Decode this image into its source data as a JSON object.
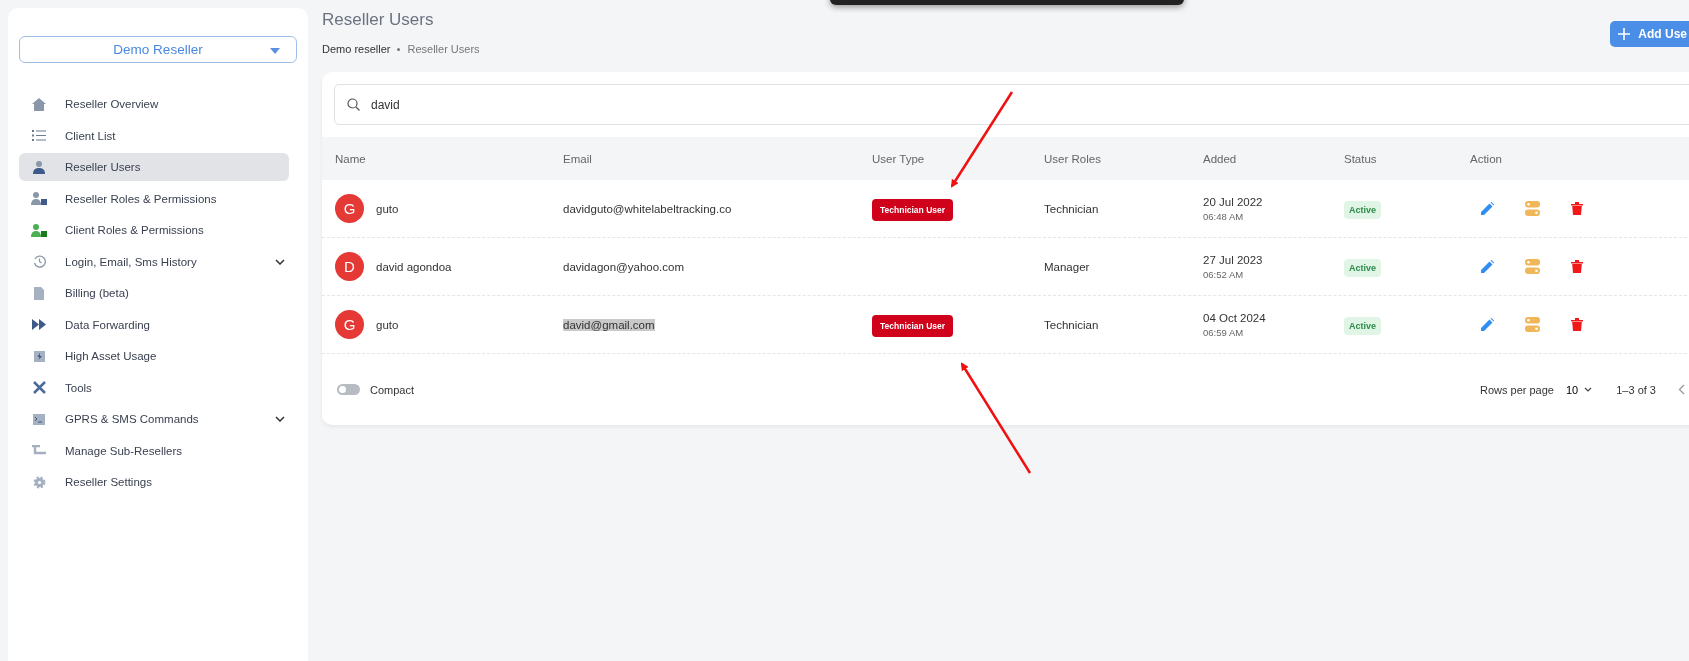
{
  "sidebar": {
    "reseller_select": "Demo Reseller",
    "items": [
      {
        "label": "Reseller Overview",
        "kind": "home",
        "selected": false,
        "expandable": false
      },
      {
        "label": "Client List",
        "kind": "list",
        "selected": false,
        "expandable": false
      },
      {
        "label": "Reseller Users",
        "kind": "user",
        "selected": true,
        "expandable": false
      },
      {
        "label": "Reseller Roles & Permissions",
        "kind": "reseller-roles",
        "selected": false,
        "expandable": false
      },
      {
        "label": "Client Roles & Permissions",
        "kind": "client-roles",
        "selected": false,
        "expandable": false
      },
      {
        "label": "Login, Email, Sms History",
        "kind": "history",
        "selected": false,
        "expandable": true
      },
      {
        "label": "Billing (beta)",
        "kind": "billing",
        "selected": false,
        "expandable": false
      },
      {
        "label": "Data Forwarding",
        "kind": "forwarding",
        "selected": false,
        "expandable": false
      },
      {
        "label": "High Asset Usage",
        "kind": "usage",
        "selected": false,
        "expandable": false
      },
      {
        "label": "Tools",
        "kind": "tools",
        "selected": false,
        "expandable": false
      },
      {
        "label": "GPRS & SMS Commands",
        "kind": "commands",
        "selected": false,
        "expandable": true
      },
      {
        "label": "Manage Sub-Resellers",
        "kind": "sub-resellers",
        "selected": false,
        "expandable": false
      },
      {
        "label": "Reseller Settings",
        "kind": "settings",
        "selected": false,
        "expandable": false
      }
    ]
  },
  "page": {
    "title": "Reseller Users",
    "breadcrumb": [
      "Demo reseller",
      "Reseller Users"
    ],
    "add_button": "Add Use"
  },
  "search": {
    "value": "david"
  },
  "table": {
    "columns": [
      "Name",
      "Email",
      "User Type",
      "User Roles",
      "Added",
      "Status",
      "Action"
    ],
    "rows": [
      {
        "initial": "G",
        "name": "guto",
        "email": "davidguto@whitelabeltracking.co",
        "email_highlighted": false,
        "user_type": "Technician User",
        "role": "Technician",
        "date": "20 Jul 2022",
        "time": "06:48 AM",
        "status": "Active"
      },
      {
        "initial": "D",
        "name": "david agondoa",
        "email": "davidagon@yahoo.com",
        "email_highlighted": false,
        "role": "Manager",
        "date": "27 Jul 2023",
        "time": "06:52 AM",
        "status": "Active"
      },
      {
        "initial": "G",
        "name": "guto",
        "email": "david@gmail.com",
        "email_highlighted": true,
        "user_type": "Technician User",
        "role": "Technician",
        "date": "04 Oct 2024",
        "time": "06:59 AM",
        "status": "Active"
      }
    ]
  },
  "footer": {
    "compact": {
      "label": "Compact",
      "on": false
    },
    "rows_per_page_label": "Rows per page",
    "rows_per_page": "10",
    "range": "1–3 of 3"
  }
}
